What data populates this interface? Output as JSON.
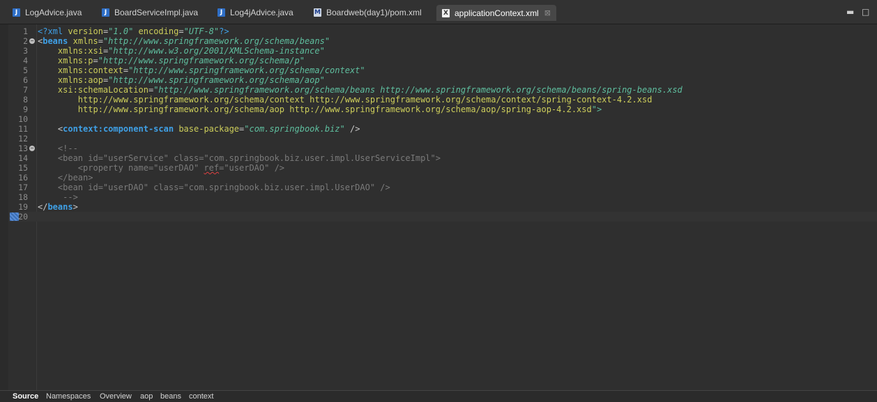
{
  "tabs": [
    {
      "label": "LogAdvice.java",
      "icon": "java-file-icon",
      "glyph": "J"
    },
    {
      "label": "BoardServiceImpl.java",
      "icon": "java-file-icon",
      "glyph": "J"
    },
    {
      "label": "Log4jAdvice.java",
      "icon": "java-file-icon",
      "glyph": "J"
    },
    {
      "label": "Boardweb(day1)/pom.xml",
      "icon": "maven-file-icon",
      "glyph": "M"
    },
    {
      "label": "applicationContext.xml",
      "icon": "xml-file-icon",
      "glyph": "X",
      "active": true,
      "close": "⊠"
    }
  ],
  "window_controls": {
    "minimize": "▬",
    "maximize": "□"
  },
  "editor": {
    "line_numbers": [
      "1",
      "2",
      "3",
      "4",
      "5",
      "6",
      "7",
      "8",
      "9",
      "10",
      "11",
      "12",
      "13",
      "14",
      "15",
      "16",
      "17",
      "18",
      "19",
      "20"
    ],
    "current_line": "20",
    "fold_markers": [
      "2",
      "13"
    ],
    "lines": [
      "<?xml version=\"1.0\" encoding=\"UTF-8\"?>",
      "<beans xmlns=\"http://www.springframework.org/schema/beans\"",
      "    xmlns:xsi=\"http://www.w3.org/2001/XMLSchema-instance\"",
      "    xmlns:p=\"http://www.springframework.org/schema/p\"",
      "    xmlns:context=\"http://www.springframework.org/schema/context\"",
      "    xmlns:aop=\"http://www.springframework.org/schema/aop\"",
      "    xsi:schemaLocation=\"http://www.springframework.org/schema/beans http://www.springframework.org/schema/beans/spring-beans.xsd",
      "        http://www.springframework.org/schema/context http://www.springframework.org/schema/context/spring-context-4.2.xsd",
      "        http://www.springframework.org/schema/aop http://www.springframework.org/schema/aop/spring-aop-4.2.xsd\">",
      "",
      "    <context:component-scan base-package=\"com.springbook.biz\" />",
      "",
      "    <!--",
      "    <bean id=\"userService\" class=\"com.springbook.biz.user.impl.UserServiceImpl\">",
      "        <property name=\"userDAO\" ref=\"userDAO\" />",
      "    </bean>",
      "    <bean id=\"userDAO\" class=\"com.springbook.biz.user.impl.UserDAO\" />",
      "     -->",
      "</beans>",
      ""
    ]
  },
  "bottom_tabs": [
    {
      "label": "Source",
      "active": true
    },
    {
      "label": "Namespaces"
    },
    {
      "label": "Overview"
    },
    {
      "label": "aop"
    },
    {
      "label": "beans"
    },
    {
      "label": "context"
    }
  ]
}
